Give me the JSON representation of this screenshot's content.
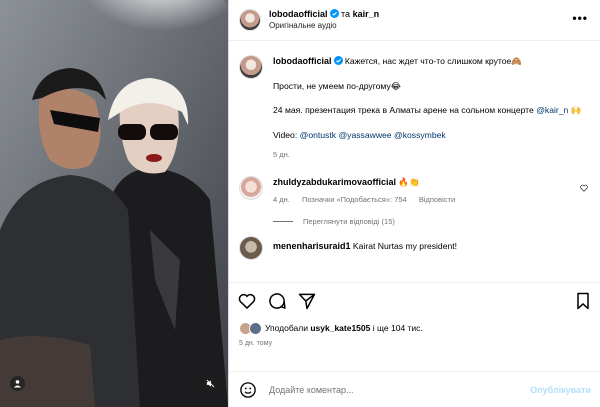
{
  "header": {
    "username": "lobodaofficial",
    "conjunction": "та",
    "collaborator": "kair_n",
    "audio": "Оригінальне аудіо"
  },
  "caption": {
    "username": "lobodaofficial",
    "line1": "Кажется, нас ждет что-то слишком крутое🙈",
    "line2": "Прости, не умеем по-другому😂",
    "line3_prefix": "24 мая. презентация трека в Алматы арене на сольном концерте ",
    "line3_mention": "@kair_n",
    "line3_suffix": " 🙌",
    "video_label": "Video: ",
    "video_mentions": [
      "@ontustk",
      "@yassawwee",
      "@kossymbek"
    ],
    "time": "5 дн."
  },
  "comments": [
    {
      "username": "zhuldyzabdukarimovaofficial",
      "text": "🔥👏",
      "time": "4 дн.",
      "likes": "Позначки «Подобається»: 754",
      "reply": "Відповісти",
      "view_replies": "Переглянути відповіді (15)"
    },
    {
      "username": "menenharisuraid1",
      "text": "Kairat Nurtas my president!"
    }
  ],
  "footer": {
    "liked_by_prefix": "Уподобали",
    "liked_by_user": "usyk_kate1505",
    "liked_by_suffix": "і ще 104 тис.",
    "time": "5 дн. тому"
  },
  "add_comment": {
    "placeholder": "Додайте коментар...",
    "publish": "Опублікувати"
  },
  "colors": {
    "accent_link": "#00376b",
    "muted": "#737373",
    "verified": "#0095f6",
    "publish_disabled": "#b2dffc",
    "fire": "#f26b1d"
  }
}
